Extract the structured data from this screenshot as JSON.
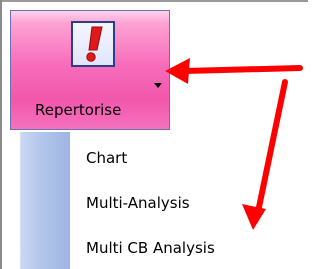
{
  "ribbon": {
    "button_label": "Repertorise",
    "icon": "exclamation-icon",
    "highlight_color": "#f257ab"
  },
  "menu": {
    "items": [
      {
        "label": "Chart"
      },
      {
        "label": "Multi-Analysis"
      },
      {
        "label": "Multi CB Analysis"
      }
    ]
  },
  "annotations": {
    "arrow_color": "#ff0000"
  }
}
